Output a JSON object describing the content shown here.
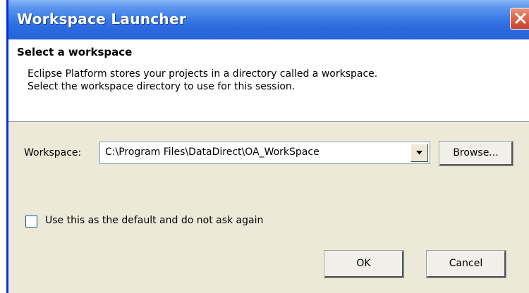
{
  "window": {
    "title": "Workspace Launcher",
    "title_bar_color": "#2c6ae0",
    "close_button_color": "#dc6b52"
  },
  "header": {
    "title": "Select a workspace",
    "description_line1": "Eclipse Platform stores your projects in a directory called a workspace.",
    "description_line2": "Select the workspace directory to use for this session."
  },
  "workspace": {
    "label": "Workspace:",
    "value": "C:\\Program Files\\DataDirect\\OA_WorkSpace",
    "browse_label": "Browse..."
  },
  "default_checkbox": {
    "label": "Use this as the default and do not ask again",
    "checked": false
  },
  "buttons": {
    "ok_label": "OK",
    "cancel_label": "Cancel"
  },
  "icons": {
    "close": "close-icon",
    "dropdown": "chevron-down-icon"
  }
}
